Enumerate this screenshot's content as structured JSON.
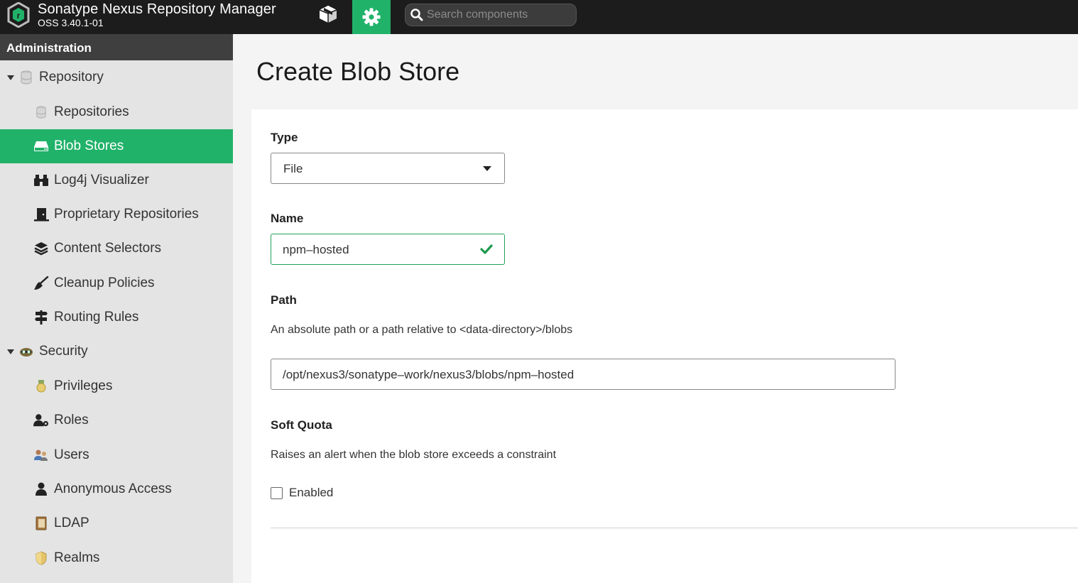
{
  "header": {
    "title": "Sonatype Nexus Repository Manager",
    "version": "OSS 3.40.1-01",
    "nav": [
      {
        "name": "browse",
        "icon": "cube-icon"
      },
      {
        "name": "administration",
        "icon": "gear-icon",
        "active": true
      }
    ],
    "search_placeholder": "Search components"
  },
  "sidebar": {
    "heading": "Administration",
    "groups": [
      {
        "label": "Repository",
        "icon": "database-icon",
        "expanded": true,
        "items": [
          {
            "label": "Repositories",
            "icon": "database-icon"
          },
          {
            "label": "Blob Stores",
            "icon": "hard-drive-icon",
            "active": true
          },
          {
            "label": "Log4j Visualizer",
            "icon": "binoculars-icon"
          },
          {
            "label": "Proprietary Repositories",
            "icon": "door-icon"
          },
          {
            "label": "Content Selectors",
            "icon": "layers-icon"
          },
          {
            "label": "Cleanup Policies",
            "icon": "broom-icon"
          },
          {
            "label": "Routing Rules",
            "icon": "signpost-icon"
          }
        ]
      },
      {
        "label": "Security",
        "icon": "spy-icon",
        "expanded": true,
        "items": [
          {
            "label": "Privileges",
            "icon": "medal-icon"
          },
          {
            "label": "Roles",
            "icon": "user-gear-icon"
          },
          {
            "label": "Users",
            "icon": "users-icon"
          },
          {
            "label": "Anonymous Access",
            "icon": "user-icon"
          },
          {
            "label": "LDAP",
            "icon": "address-book-icon"
          },
          {
            "label": "Realms",
            "icon": "shield-icon"
          }
        ]
      }
    ]
  },
  "main": {
    "title": "Create Blob Store",
    "form": {
      "type_label": "Type",
      "type_value": "File",
      "name_label": "Name",
      "name_value": "npm–hosted",
      "path_label": "Path",
      "path_help": "An absolute path or a path relative to <data-directory>/blobs",
      "path_value": "/opt/nexus3/sonatype–work/nexus3/blobs/npm–hosted",
      "soft_quota_label": "Soft Quota",
      "soft_quota_help": "Raises an alert when the blob store exceeds a constraint",
      "enabled_label": "Enabled",
      "enabled_checked": false
    }
  },
  "colors": {
    "accent": "#21b26a",
    "header_bg": "#1c1c1c",
    "sidebar_bg": "#e4e4e4",
    "valid": "#1e9a50"
  }
}
